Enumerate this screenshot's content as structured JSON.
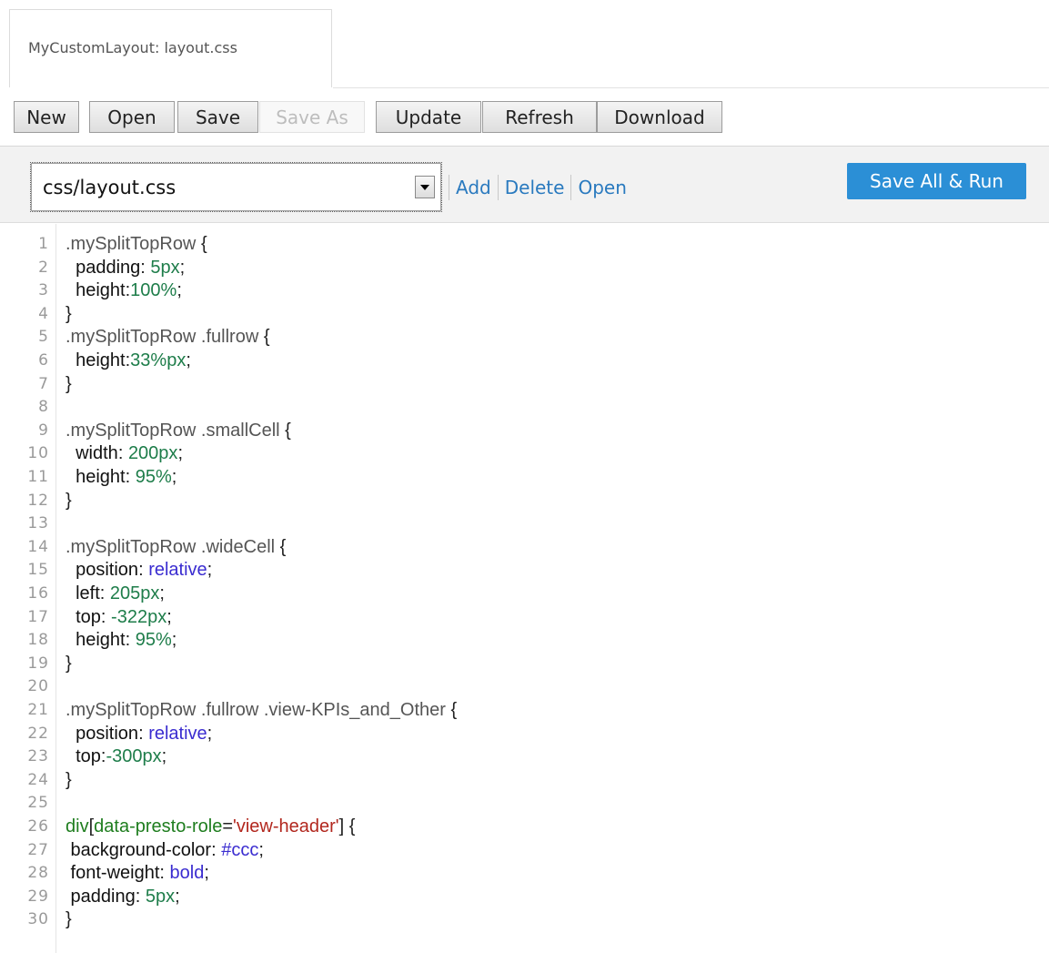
{
  "tab": {
    "title": "MyCustomLayout: layout.css"
  },
  "toolbar": {
    "buttons": [
      {
        "label": "New",
        "enabled": true
      },
      {
        "label": "Open",
        "enabled": true
      },
      {
        "label": "Save",
        "enabled": true
      },
      {
        "label": "Save As",
        "enabled": false
      },
      {
        "label": "Update",
        "enabled": true
      },
      {
        "label": "Refresh",
        "enabled": true
      },
      {
        "label": "Download",
        "enabled": true
      }
    ]
  },
  "file_bar": {
    "selected_file": "css/layout.css",
    "actions": [
      "Add",
      "Delete",
      "Open"
    ],
    "primary_button": "Save All & Run"
  },
  "colors": {
    "accent": "#2b8fd6",
    "link": "#2a7abf",
    "code_number": "#1e7d4a",
    "code_keyword": "#3a2cd0",
    "code_string": "#b2271e"
  },
  "editor": {
    "lines": [
      {
        "n": "1",
        "tokens": [
          {
            "t": ".mySplitTopRow",
            "c": "sel"
          },
          {
            "t": " {",
            "c": "punc"
          }
        ]
      },
      {
        "n": "2",
        "tokens": [
          {
            "t": "  padding",
            "c": "prop"
          },
          {
            "t": ": ",
            "c": "punc"
          },
          {
            "t": "5px",
            "c": "num"
          },
          {
            "t": ";",
            "c": "punc"
          }
        ]
      },
      {
        "n": "3",
        "tokens": [
          {
            "t": "  height",
            "c": "prop"
          },
          {
            "t": ":",
            "c": "punc"
          },
          {
            "t": "100%",
            "c": "num"
          },
          {
            "t": ";",
            "c": "punc"
          }
        ]
      },
      {
        "n": "4",
        "tokens": [
          {
            "t": "}",
            "c": "punc"
          }
        ]
      },
      {
        "n": "5",
        "tokens": [
          {
            "t": ".mySplitTopRow .fullrow",
            "c": "sel"
          },
          {
            "t": " {",
            "c": "punc"
          }
        ]
      },
      {
        "n": "6",
        "tokens": [
          {
            "t": "  height",
            "c": "prop"
          },
          {
            "t": ":",
            "c": "punc"
          },
          {
            "t": "33%px",
            "c": "num"
          },
          {
            "t": ";",
            "c": "punc"
          }
        ]
      },
      {
        "n": "7",
        "tokens": [
          {
            "t": "}",
            "c": "punc"
          }
        ]
      },
      {
        "n": "8",
        "tokens": []
      },
      {
        "n": "9",
        "tokens": [
          {
            "t": ".mySplitTopRow .smallCell",
            "c": "sel"
          },
          {
            "t": " {",
            "c": "punc"
          }
        ]
      },
      {
        "n": "10",
        "tokens": [
          {
            "t": "  width",
            "c": "prop"
          },
          {
            "t": ": ",
            "c": "punc"
          },
          {
            "t": "200px",
            "c": "num"
          },
          {
            "t": ";",
            "c": "punc"
          }
        ]
      },
      {
        "n": "11",
        "tokens": [
          {
            "t": "  height",
            "c": "prop"
          },
          {
            "t": ": ",
            "c": "punc"
          },
          {
            "t": "95%",
            "c": "num"
          },
          {
            "t": ";",
            "c": "punc"
          }
        ]
      },
      {
        "n": "12",
        "tokens": [
          {
            "t": "}",
            "c": "punc"
          }
        ]
      },
      {
        "n": "13",
        "tokens": []
      },
      {
        "n": "14",
        "tokens": [
          {
            "t": ".mySplitTopRow .wideCell",
            "c": "sel"
          },
          {
            "t": " {",
            "c": "punc"
          }
        ]
      },
      {
        "n": "15",
        "tokens": [
          {
            "t": "  position",
            "c": "prop"
          },
          {
            "t": ": ",
            "c": "punc"
          },
          {
            "t": "relative",
            "c": "kw"
          },
          {
            "t": ";",
            "c": "punc"
          }
        ]
      },
      {
        "n": "16",
        "tokens": [
          {
            "t": "  left",
            "c": "prop"
          },
          {
            "t": ": ",
            "c": "punc"
          },
          {
            "t": "205px",
            "c": "num"
          },
          {
            "t": ";",
            "c": "punc"
          }
        ]
      },
      {
        "n": "17",
        "tokens": [
          {
            "t": "  top",
            "c": "prop"
          },
          {
            "t": ": ",
            "c": "punc"
          },
          {
            "t": "-322px",
            "c": "num"
          },
          {
            "t": ";",
            "c": "punc"
          }
        ]
      },
      {
        "n": "18",
        "tokens": [
          {
            "t": "  height",
            "c": "prop"
          },
          {
            "t": ": ",
            "c": "punc"
          },
          {
            "t": "95%",
            "c": "num"
          },
          {
            "t": ";",
            "c": "punc"
          }
        ]
      },
      {
        "n": "19",
        "tokens": [
          {
            "t": "}",
            "c": "punc"
          }
        ]
      },
      {
        "n": "20",
        "tokens": []
      },
      {
        "n": "21",
        "tokens": [
          {
            "t": ".mySplitTopRow .fullrow .view-KPIs_and_Other",
            "c": "sel"
          },
          {
            "t": " {",
            "c": "punc"
          }
        ]
      },
      {
        "n": "22",
        "tokens": [
          {
            "t": "  position",
            "c": "prop"
          },
          {
            "t": ": ",
            "c": "punc"
          },
          {
            "t": "relative",
            "c": "kw"
          },
          {
            "t": ";",
            "c": "punc"
          }
        ]
      },
      {
        "n": "23",
        "tokens": [
          {
            "t": "  top",
            "c": "prop"
          },
          {
            "t": ":",
            "c": "punc"
          },
          {
            "t": "-300px",
            "c": "num"
          },
          {
            "t": ";",
            "c": "punc"
          }
        ]
      },
      {
        "n": "24",
        "tokens": [
          {
            "t": "}",
            "c": "punc"
          }
        ]
      },
      {
        "n": "25",
        "tokens": []
      },
      {
        "n": "26",
        "tokens": [
          {
            "t": "div",
            "c": "tag"
          },
          {
            "t": "[",
            "c": "punc"
          },
          {
            "t": "data-presto-role",
            "c": "tag"
          },
          {
            "t": "=",
            "c": "punc"
          },
          {
            "t": "'view-header'",
            "c": "str"
          },
          {
            "t": "] {",
            "c": "punc"
          }
        ]
      },
      {
        "n": "27",
        "tokens": [
          {
            "t": " background-color",
            "c": "prop"
          },
          {
            "t": ": ",
            "c": "punc"
          },
          {
            "t": "#ccc",
            "c": "kw"
          },
          {
            "t": ";",
            "c": "punc"
          }
        ]
      },
      {
        "n": "28",
        "tokens": [
          {
            "t": " font-weight",
            "c": "prop"
          },
          {
            "t": ": ",
            "c": "punc"
          },
          {
            "t": "bold",
            "c": "kw"
          },
          {
            "t": ";",
            "c": "punc"
          }
        ]
      },
      {
        "n": "29",
        "tokens": [
          {
            "t": " padding",
            "c": "prop"
          },
          {
            "t": ": ",
            "c": "punc"
          },
          {
            "t": "5px",
            "c": "num"
          },
          {
            "t": ";",
            "c": "punc"
          }
        ]
      },
      {
        "n": "30",
        "tokens": [
          {
            "t": "}",
            "c": "punc"
          }
        ]
      }
    ]
  }
}
